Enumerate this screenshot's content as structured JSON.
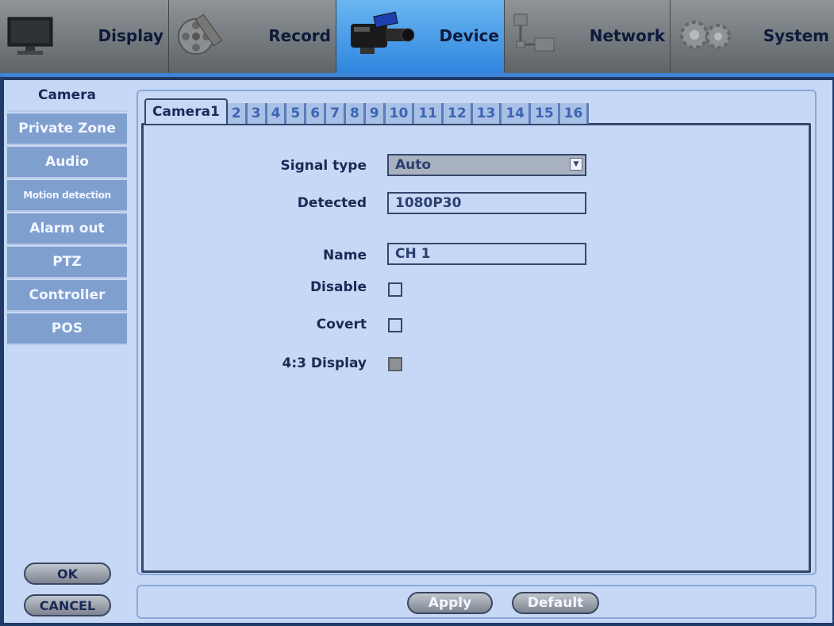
{
  "topmenu": [
    {
      "label": "Display",
      "icon": "monitor-icon"
    },
    {
      "label": "Record",
      "icon": "film-reel-icon"
    },
    {
      "label": "Device",
      "icon": "camcorder-icon",
      "active": true
    },
    {
      "label": "Network",
      "icon": "network-icon"
    },
    {
      "label": "System",
      "icon": "gears-icon"
    }
  ],
  "sidebar": {
    "items": [
      "Camera",
      "Private Zone",
      "Audio",
      "Motion detection",
      "Alarm out",
      "PTZ",
      "Controller",
      "POS"
    ],
    "ok_label": "OK",
    "cancel_label": "CANCEL"
  },
  "tabs": [
    "Camera1",
    "2",
    "3",
    "4",
    "5",
    "6",
    "7",
    "8",
    "9",
    "10",
    "11",
    "12",
    "13",
    "14",
    "15",
    "16"
  ],
  "form": {
    "signal_type_label": "Signal type",
    "signal_type_value": "Auto",
    "detected_label": "Detected",
    "detected_value": "1080P30",
    "name_label": "Name",
    "name_value": "CH 1",
    "disable_label": "Disable",
    "disable_checked": false,
    "covert_label": "Covert",
    "covert_checked": false,
    "display43_label": "4:3 Display",
    "display43_enabled": false
  },
  "footer": {
    "apply_label": "Apply",
    "default_label": "Default"
  },
  "colors": {
    "active_tab": "#2f86de",
    "panel_bg": "#c6d8f5",
    "sidebar_item": "#7f9fcf"
  }
}
